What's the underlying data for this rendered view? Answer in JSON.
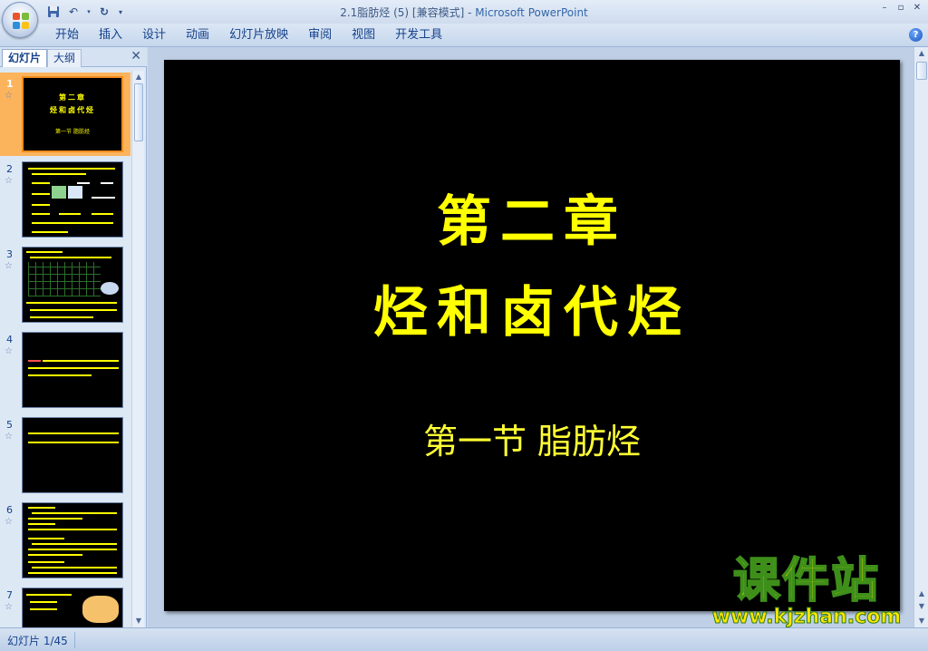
{
  "window": {
    "title": "2.1脂肪烃 (5) [兼容模式] - ",
    "app_name": "Microsoft PowerPoint",
    "controls": [
      "–",
      "▫",
      "✕"
    ]
  },
  "ribbon": {
    "tabs": [
      "开始",
      "插入",
      "设计",
      "动画",
      "幻灯片放映",
      "审阅",
      "视图",
      "开发工具"
    ],
    "help": "?"
  },
  "left_pane": {
    "tabs": {
      "slides": "幻灯片",
      "outline": "大纲"
    },
    "close": "✕",
    "thumbnails": [
      {
        "number": "1",
        "star": "☆"
      },
      {
        "number": "2",
        "star": "☆"
      },
      {
        "number": "3",
        "star": "☆"
      },
      {
        "number": "4",
        "star": "☆"
      },
      {
        "number": "5",
        "star": "☆"
      },
      {
        "number": "6",
        "star": "☆"
      },
      {
        "number": "7",
        "star": "☆"
      }
    ]
  },
  "slide": {
    "title_line1": "第二章",
    "title_line2": "烃和卤代烃",
    "subtitle": "第一节 脂肪烃",
    "text_color": "#ffff00",
    "background": "#000000"
  },
  "thumb1": {
    "line1": "第二章",
    "line2": "烃和卤代烃",
    "line3": "第一节 脂肪烃"
  },
  "watermark": {
    "top": "课件站",
    "bottom": "www.kjzhan.com"
  },
  "status": {
    "slide_counter": "幻灯片 1/45"
  },
  "colors": {
    "active_thumb": "#fbb45c",
    "ribbon_text": "#15428b"
  }
}
